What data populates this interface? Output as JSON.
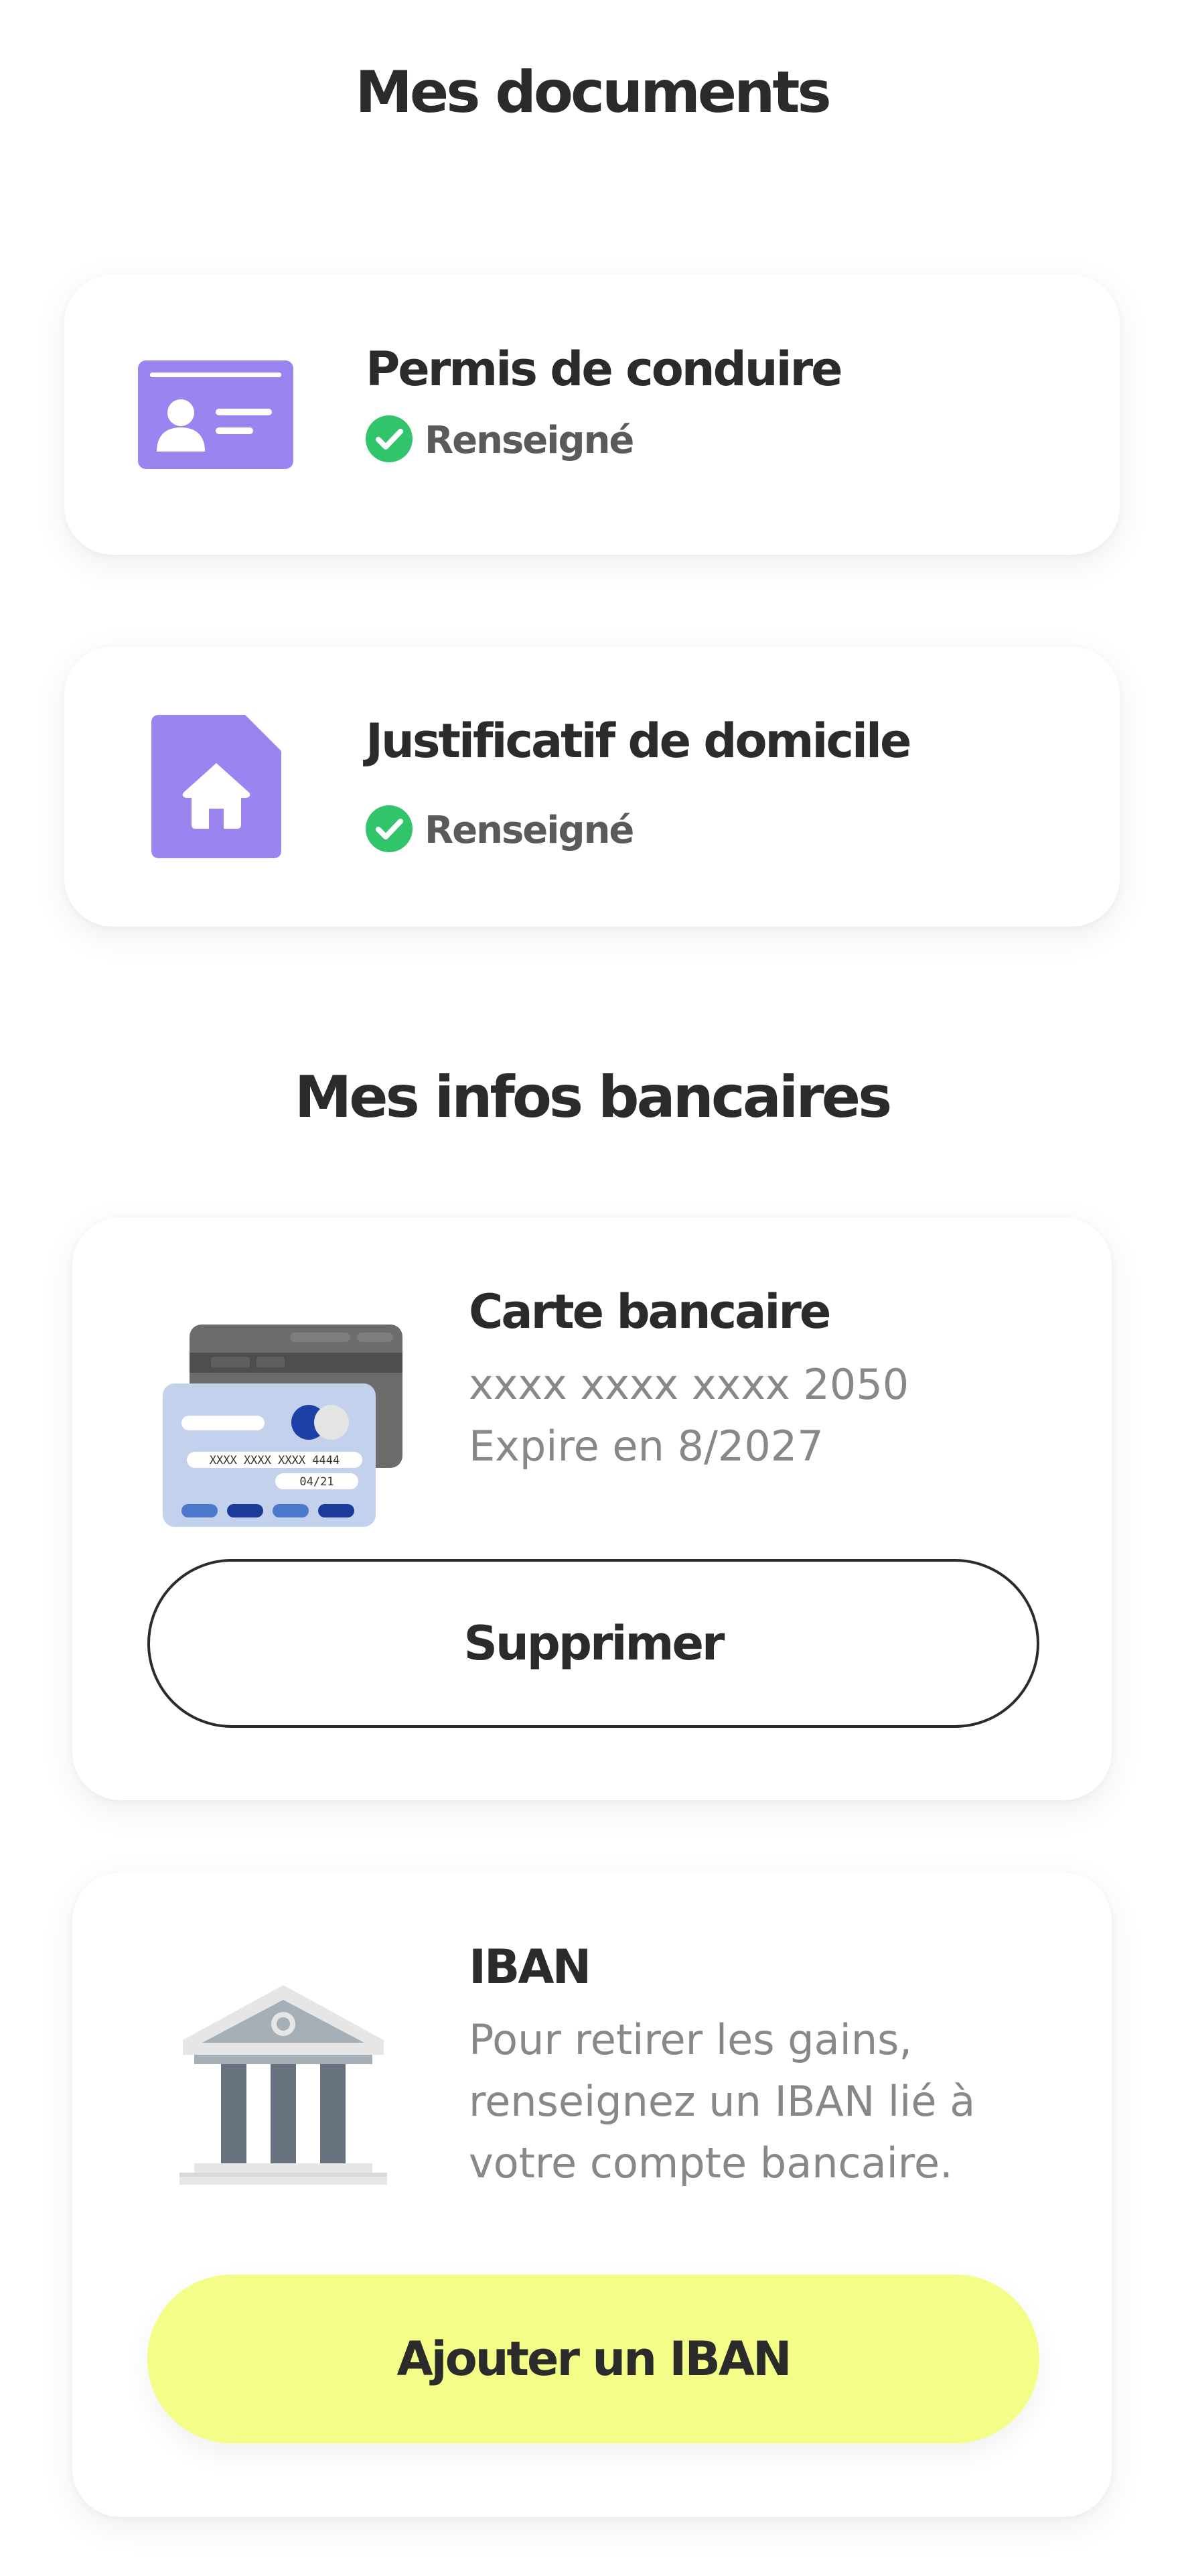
{
  "documents": {
    "title": "Mes documents",
    "items": [
      {
        "label": "Permis de conduire",
        "status": "Renseigné",
        "icon": "id-card-icon"
      },
      {
        "label": "Justificatif de domicile",
        "status": "Renseigné",
        "icon": "home-document-icon"
      }
    ]
  },
  "bank": {
    "title": "Mes infos bancaires",
    "card": {
      "title": "Carte bancaire",
      "number": "xxxx xxxx xxxx 2050",
      "expiry": "Expire en 8/2027",
      "illustration_number": "XXXX XXXX XXXX 4444",
      "illustration_expiry": "04/21",
      "delete_label": "Supprimer",
      "icon": "credit-card-icon"
    },
    "iban": {
      "title": "IBAN",
      "description_lines": [
        "Pour retirer les gains,",
        "renseignez un IBAN lié à",
        "votre compte bancaire."
      ],
      "add_label": "Ajouter un IBAN",
      "icon": "bank-building-icon"
    }
  },
  "colors": {
    "accent_purple": "#9b84ef",
    "success_green": "#31c46a",
    "button_yellow": "#f4fd87",
    "text_dark": "#2b2b2b",
    "text_muted": "#888888"
  }
}
